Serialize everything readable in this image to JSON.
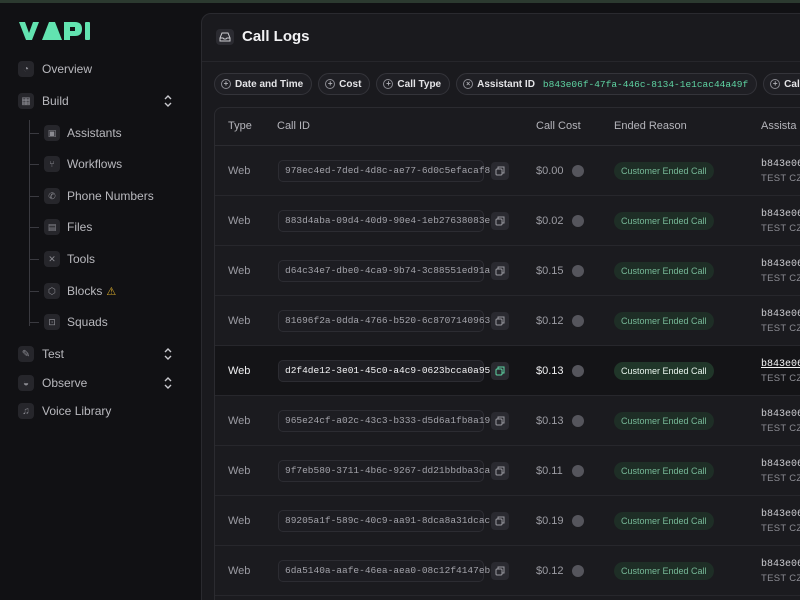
{
  "brand": {
    "logo_text": "VAPI",
    "logo_color": "#62e3b0"
  },
  "sidebar": {
    "overview": {
      "label": "Overview",
      "icon": "overview-icon"
    },
    "build": {
      "label": "Build",
      "icon": "build-icon"
    },
    "build_items": [
      {
        "label": "Assistants",
        "icon": "assistant-icon"
      },
      {
        "label": "Workflows",
        "icon": "workflow-icon"
      },
      {
        "label": "Phone Numbers",
        "icon": "phone-icon"
      },
      {
        "label": "Files",
        "icon": "file-icon"
      },
      {
        "label": "Tools",
        "icon": "tools-icon"
      },
      {
        "label": "Blocks",
        "icon": "blocks-icon"
      },
      {
        "label": "Squads",
        "icon": "squads-icon"
      }
    ],
    "blocks_warning": "⚠",
    "test": {
      "label": "Test",
      "icon": "test-icon"
    },
    "observe": {
      "label": "Observe",
      "icon": "observe-icon"
    },
    "voice_library": {
      "label": "Voice Library",
      "icon": "voice-library-icon"
    }
  },
  "main": {
    "title": "Call Logs",
    "filters": [
      {
        "label": "Date and Time"
      },
      {
        "label": "Cost"
      },
      {
        "label": "Call Type"
      },
      {
        "label": "Assistant ID",
        "value": "b843e06f-47fa-446c-8134-1e1cac44a49f"
      },
      {
        "label": "Call ID"
      }
    ],
    "filter_overflow": "C",
    "table": {
      "headers": {
        "type": "Type",
        "call_id": "Call ID",
        "call_cost": "Call Cost",
        "ended_reason": "Ended Reason",
        "assistant": "Assista"
      },
      "rows": [
        {
          "type": "Web",
          "call_id": "978ec4ed-7ded-4d8c-ae77-6d0c5efacaf8",
          "cost": "$0.00",
          "ended_reason": "Customer Ended Call",
          "assistant_id": "b843e06",
          "assistant_name": "TEST CZ"
        },
        {
          "type": "Web",
          "call_id": "883d4aba-09d4-40d9-90e4-1eb27638083e",
          "cost": "$0.02",
          "ended_reason": "Customer Ended Call",
          "assistant_id": "b843e06",
          "assistant_name": "TEST CZ"
        },
        {
          "type": "Web",
          "call_id": "d64c34e7-dbe0-4ca9-9b74-3c88551ed91a",
          "cost": "$0.15",
          "ended_reason": "Customer Ended Call",
          "assistant_id": "b843e06",
          "assistant_name": "TEST CZ"
        },
        {
          "type": "Web",
          "call_id": "81696f2a-0dda-4766-b520-6c8707140963",
          "cost": "$0.12",
          "ended_reason": "Customer Ended Call",
          "assistant_id": "b843e06",
          "assistant_name": "TEST CZ"
        },
        {
          "type": "Web",
          "call_id": "d2f4de12-3e01-45c0-a4c9-0623bcca0a95",
          "cost": "$0.13",
          "ended_reason": "Customer Ended Call",
          "assistant_id": "b843e06",
          "assistant_name": "TEST CZ",
          "active": true
        },
        {
          "type": "Web",
          "call_id": "965e24cf-a02c-43c3-b333-d5d6a1fb8a19",
          "cost": "$0.13",
          "ended_reason": "Customer Ended Call",
          "assistant_id": "b843e06",
          "assistant_name": "TEST CZ"
        },
        {
          "type": "Web",
          "call_id": "9f7eb580-3711-4b6c-9267-dd21bbdba3ca",
          "cost": "$0.11",
          "ended_reason": "Customer Ended Call",
          "assistant_id": "b843e06",
          "assistant_name": "TEST CZ"
        },
        {
          "type": "Web",
          "call_id": "89205a1f-589c-40c9-aa91-8dca8a31dcac",
          "cost": "$0.19",
          "ended_reason": "Customer Ended Call",
          "assistant_id": "b843e06",
          "assistant_name": "TEST CZ"
        },
        {
          "type": "Web",
          "call_id": "6da5140a-aafe-46ea-aea0-08c12f4147eb",
          "cost": "$0.12",
          "ended_reason": "Customer Ended Call",
          "assistant_id": "b843e06",
          "assistant_name": "TEST CZ"
        }
      ]
    }
  }
}
